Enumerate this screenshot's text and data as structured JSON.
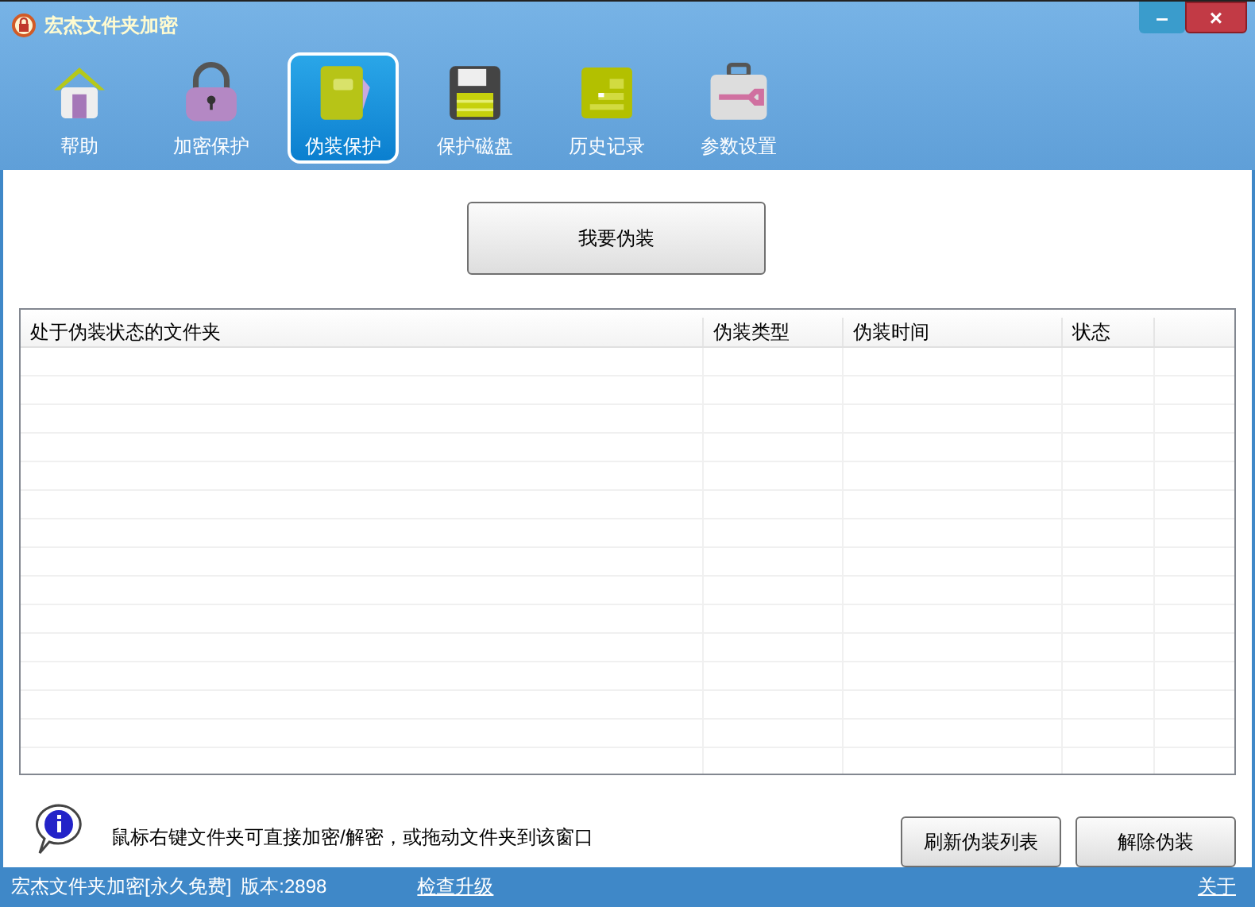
{
  "window": {
    "title": "宏杰文件夹加密",
    "controls": [
      "–",
      "×"
    ]
  },
  "tabs": [
    {
      "label": "帮助",
      "kind": "home",
      "selected": false
    },
    {
      "label": "加密保护",
      "kind": "lock",
      "selected": false
    },
    {
      "label": "伪装保护",
      "kind": "book",
      "selected": true
    },
    {
      "label": "保护磁盘",
      "kind": "disk",
      "selected": false
    },
    {
      "label": "历史记录",
      "kind": "chart",
      "selected": false
    },
    {
      "label": "参数设置",
      "kind": "toolbox",
      "selected": false
    }
  ],
  "primary_button": "我要伪装",
  "table": {
    "columns": [
      "处于伪装状态的文件夹",
      "伪装类型",
      "伪装时间",
      "状态"
    ]
  },
  "hint": "鼠标右键文件夹可直接加密/解密，或拖动文件夹到该窗口",
  "buttons": [
    "刷新伪装列表",
    "解除伪装"
  ],
  "status_bar": {
    "product": "宏杰文件夹加密[永久免费]",
    "version": "版本:2898",
    "update_link": "检查升级",
    "about_link": "关于"
  }
}
